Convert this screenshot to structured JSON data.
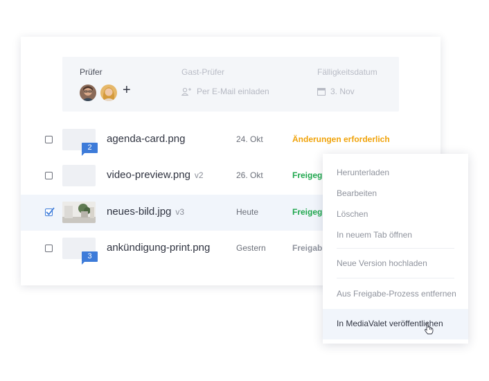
{
  "reviewers": {
    "pruefer_label": "Prüfer",
    "guest_label": "Gast-Prüfer",
    "guest_placeholder": "Per E-Mail einladen",
    "due_label": "Fälligkeitsdatum",
    "due_value": "3. Nov",
    "add_symbol": "+"
  },
  "files": [
    {
      "name": "agenda-card.png",
      "version": "",
      "date": "24. Okt",
      "status": "Änderungen erforderlich",
      "status_color": "#f0a30a",
      "badge": "2",
      "checked": false
    },
    {
      "name": "video-preview.png",
      "version": "v2",
      "date": "26. Okt",
      "status": "Freigegeben",
      "status_color": "#1fa74d",
      "badge": "",
      "checked": false
    },
    {
      "name": "neues-bild.jpg",
      "version": "v3",
      "date": "Heute",
      "status": "Freigegeben",
      "status_color": "#1fa74d",
      "badge": "",
      "checked": true
    },
    {
      "name": "ankündigung-print.png",
      "version": "",
      "date": "Gestern",
      "status": "Freigabe",
      "status_color": "#8f939d",
      "badge": "3",
      "checked": false
    }
  ],
  "menu": {
    "download": "Herunterladen",
    "edit": "Bearbeiten",
    "delete": "Löschen",
    "open_new_tab": "In neuem Tab öffnen",
    "upload_version": "Neue Version hochladen",
    "remove_from_approval": "Aus Freigabe-Prozess entfernen",
    "publish": "In MediaValet veröffentlichen"
  },
  "colors": {
    "accent": "#3d7bd9",
    "approved": "#1fa74d",
    "changes": "#f0a30a"
  }
}
